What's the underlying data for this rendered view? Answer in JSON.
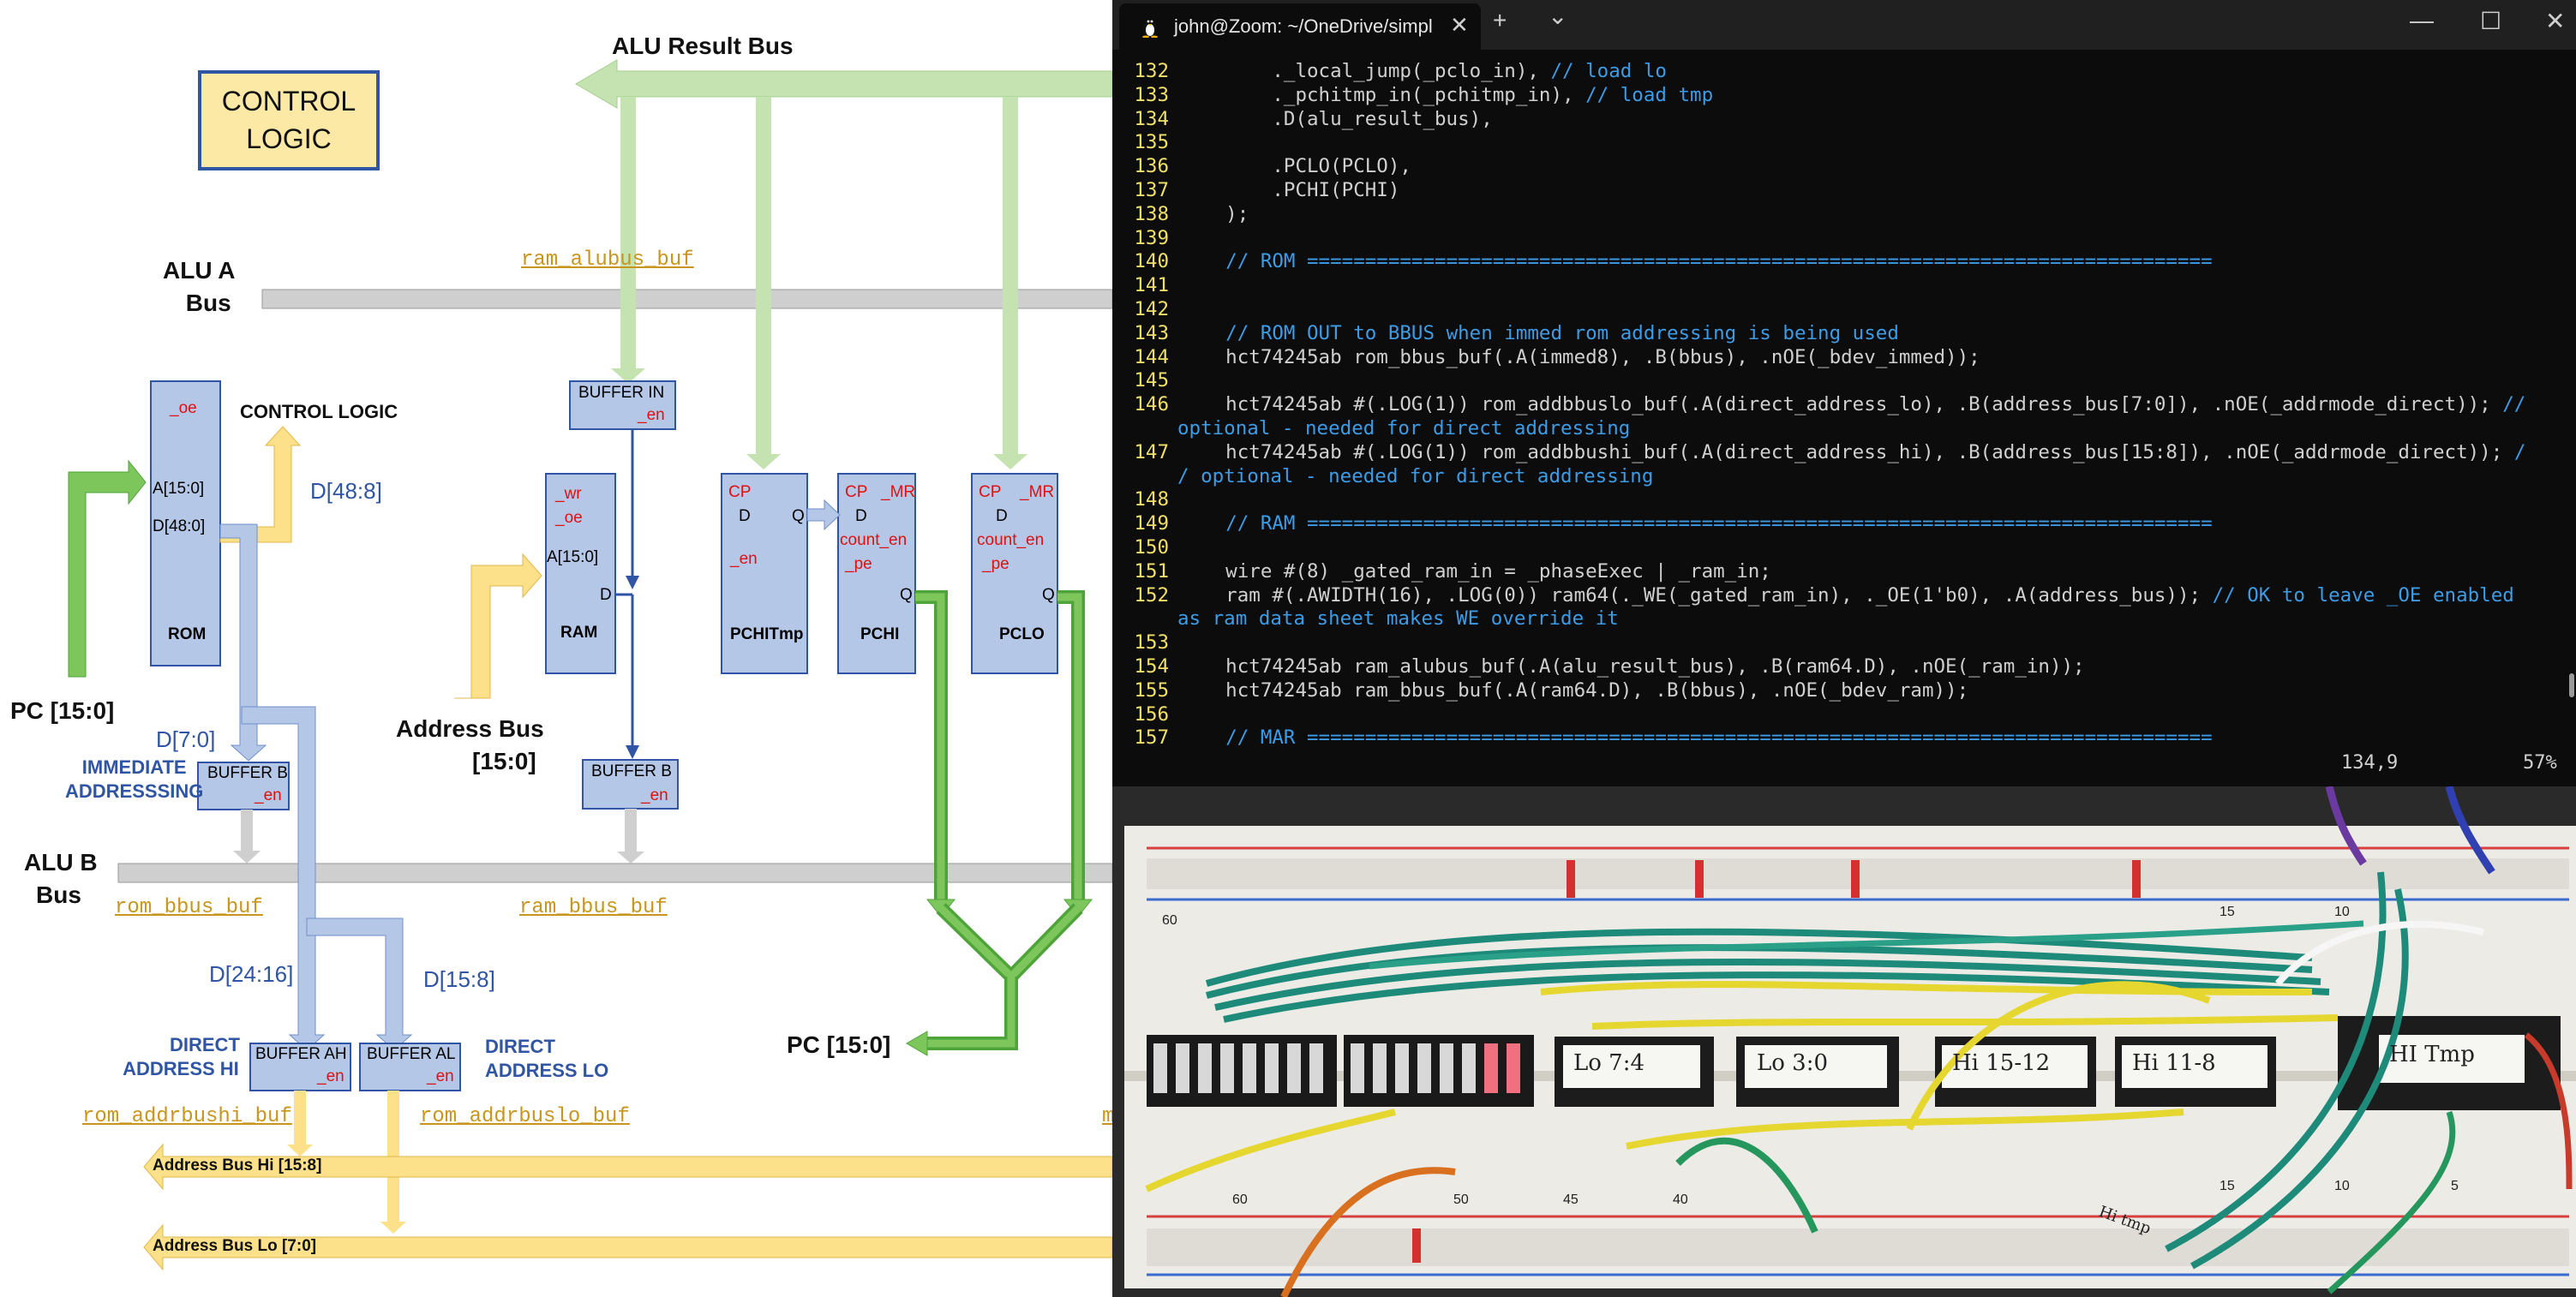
{
  "diagram": {
    "control_logic_box": [
      "CONTROL",
      "LOGIC"
    ],
    "alu_result_bus": "ALU Result Bus",
    "alu_a_bus": [
      "ALU A",
      "Bus"
    ],
    "alu_b_bus": [
      "ALU B",
      "Bus"
    ],
    "pc_left": "PC [15:0]",
    "pc_bottom": "PC [15:0]",
    "address_bus": [
      "Address Bus",
      "[15:0]"
    ],
    "control_logic_small": "CONTROL LOGIC",
    "rom": {
      "oe": "_oe",
      "addr": "A[15:0]",
      "data": "D[48:0]",
      "name": "ROM"
    },
    "d48_8": "D[48:8]",
    "d7_0": "D[7:0]",
    "d24_16": "D[24:16]",
    "d15_8": "D[15:8]",
    "immediate": [
      "IMMEDIATE",
      "ADDRESSSING"
    ],
    "direct_hi": [
      "DIRECT",
      "ADDRESS  HI"
    ],
    "direct_lo": [
      "DIRECT",
      "ADDRESS LO"
    ],
    "buffer_b_rom": [
      "BUFFER B",
      "_en"
    ],
    "buffer_in": [
      "BUFFER IN",
      "_en"
    ],
    "buffer_b_ram": [
      "BUFFER B",
      "_en"
    ],
    "buffer_ah": [
      "BUFFER AH",
      "_en"
    ],
    "buffer_al": [
      "BUFFER AL",
      "_en"
    ],
    "ram": {
      "wr": "_wr",
      "oe": "_oe",
      "addr": "A[15:0]",
      "d": "D",
      "name": "RAM"
    },
    "pchitmp": {
      "cp": "CP",
      "d": "D",
      "q": "Q",
      "en": "_en",
      "name": "PCHITmp"
    },
    "pchi": {
      "cp": "CP",
      "mr": "_MR",
      "d": "D",
      "count_en": "count_en",
      "pe": "_pe",
      "q": "Q",
      "name": "PCHI"
    },
    "pclo": {
      "cp": "CP",
      "mr": "_MR",
      "d": "D",
      "count_en": "count_en",
      "pe": "_pe",
      "q": "Q",
      "name": "PCLO"
    },
    "ram_alubus_buf": "ram_alubus_buf",
    "rom_bbus_buf": "rom_bbus_buf",
    "ram_bbus_buf": "ram_bbus_buf",
    "rom_addrbushi_buf": "rom_addrbushi_buf",
    "rom_addrbuslo_buf": "rom_addrbuslo_buf",
    "clipped_m": "m",
    "address_bus_hi": "Address Bus Hi [15:8]",
    "address_bus_lo": "Address Bus Lo [7:0]"
  },
  "terminal": {
    "tab_title": "john@Zoom: ~/OneDrive/simpl",
    "tab_close": "✕",
    "new_tab": "+",
    "dropdown": "⌄",
    "minimize": "—",
    "maximize": "☐",
    "close": "✕",
    "lines": [
      {
        "n": "132",
        "code": "        ._local_jump(_pclo_in), ",
        "cmt": "// load lo"
      },
      {
        "n": "133",
        "code": "        ._pchitmp_in(_pchitmp_in), ",
        "cmt": "// load tmp"
      },
      {
        "n": "134",
        "code": "        .D(alu_result_bus),",
        "cmt": ""
      },
      {
        "n": "135",
        "code": "",
        "cmt": ""
      },
      {
        "n": "136",
        "code": "        .PCLO(PCLO),",
        "cmt": ""
      },
      {
        "n": "137",
        "code": "        .PCHI(PCHI)",
        "cmt": ""
      },
      {
        "n": "138",
        "code": "    );",
        "cmt": ""
      },
      {
        "n": "139",
        "code": "",
        "cmt": ""
      },
      {
        "n": "140",
        "code": "    ",
        "cmt": "// ROM =============================================================================="
      },
      {
        "n": "141",
        "code": "",
        "cmt": ""
      },
      {
        "n": "142",
        "code": "",
        "cmt": ""
      },
      {
        "n": "143",
        "code": "    ",
        "cmt": "// ROM OUT to BBUS when immed rom addressing is being used"
      },
      {
        "n": "144",
        "code": "    hct74245ab rom_bbus_buf(.A(immed8), .B(bbus), .nOE(_bdev_immed));",
        "cmt": ""
      },
      {
        "n": "145",
        "code": "",
        "cmt": ""
      },
      {
        "n": "146",
        "code": "    hct74245ab #(.LOG(1)) rom_addbbuslo_buf(.A(direct_address_lo), .B(address_bus[7:0]), .nOE(_addrmode_direct)); ",
        "cmt": "//"
      },
      {
        "n": "",
        "code": "",
        "cmt": "optional - needed for direct addressing"
      },
      {
        "n": "147",
        "code": "    hct74245ab #(.LOG(1)) rom_addbbushi_buf(.A(direct_address_hi), .B(address_bus[15:8]), .nOE(_addrmode_direct)); ",
        "cmt": "/"
      },
      {
        "n": "",
        "code": "",
        "cmt": "/ optional - needed for direct addressing"
      },
      {
        "n": "148",
        "code": "",
        "cmt": ""
      },
      {
        "n": "149",
        "code": "    ",
        "cmt": "// RAM =============================================================================="
      },
      {
        "n": "150",
        "code": "",
        "cmt": ""
      },
      {
        "n": "151",
        "code": "    wire #(8) _gated_ram_in = _phaseExec | _ram_in;",
        "cmt": ""
      },
      {
        "n": "152",
        "code": "    ram #(.AWIDTH(16), .LOG(0)) ram64(._WE(_gated_ram_in), ._OE(1'b0), .A(address_bus)); ",
        "cmt": "// OK to leave _OE enabled"
      },
      {
        "n": "",
        "code": "",
        "cmt": "as ram data sheet makes WE override it"
      },
      {
        "n": "153",
        "code": "",
        "cmt": ""
      },
      {
        "n": "154",
        "code": "    hct74245ab ram_alubus_buf(.A(alu_result_bus), .B(ram64.D), .nOE(_ram_in));",
        "cmt": ""
      },
      {
        "n": "155",
        "code": "    hct74245ab ram_bbus_buf(.A(ram64.D), .B(bbus), .nOE(_bdev_ram));",
        "cmt": ""
      },
      {
        "n": "156",
        "code": "",
        "cmt": ""
      },
      {
        "n": "157",
        "code": "    ",
        "cmt": "// MAR =============================================================================="
      }
    ],
    "status_pos": "134,9",
    "status_pct": "57%"
  },
  "photo": {
    "chip_labels": [
      "Lo 7:4",
      "Lo 3:0",
      "Hi 15-12",
      "Hi 11-8",
      "HI Tmp",
      "Hi tmp"
    ],
    "row_numbers": [
      "60",
      "15",
      "10",
      "60",
      "50",
      "45",
      "40",
      "15",
      "10",
      "5"
    ]
  }
}
